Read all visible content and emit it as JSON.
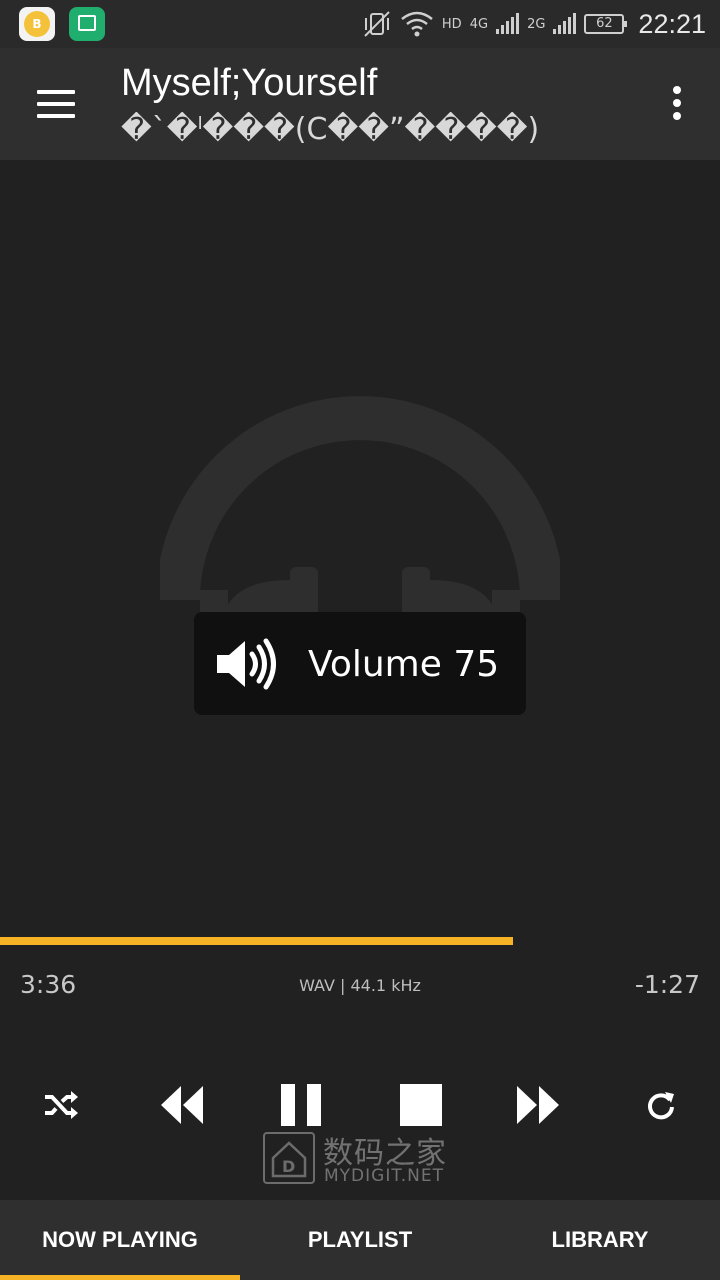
{
  "status_bar": {
    "network_label": "HD",
    "network_4g": "4G",
    "network_2g": "2G",
    "battery": "62",
    "time": "22:21"
  },
  "header": {
    "title": "Myself;Yourself",
    "subtitle": "�`�ˡ���(C��”����)"
  },
  "volume_toast": {
    "text": "Volume 75"
  },
  "player": {
    "elapsed": "3:36",
    "remaining": "-1:27",
    "format": "WAV | 44.1 kHz",
    "progress_fraction": 0.713
  },
  "watermark": {
    "cn": "数码之家",
    "en": "MYDIGIT.NET"
  },
  "tabs": [
    {
      "label": "NOW PLAYING",
      "active": true
    },
    {
      "label": "PLAYLIST",
      "active": false
    },
    {
      "label": "LIBRARY",
      "active": false
    }
  ],
  "colors": {
    "accent": "#f5b325",
    "background": "#212121",
    "toolbar": "#2f2f2f"
  }
}
